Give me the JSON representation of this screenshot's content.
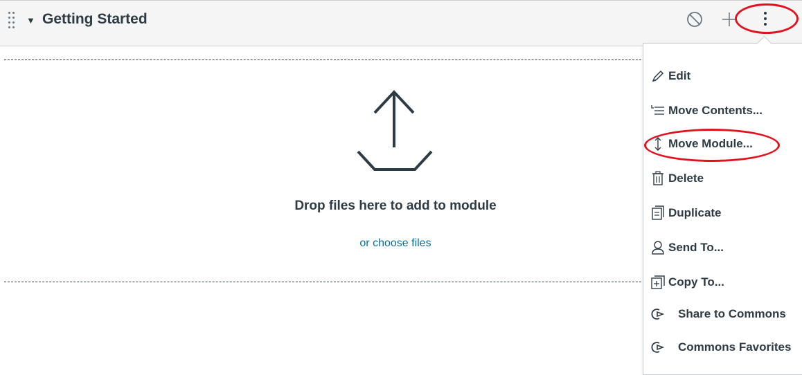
{
  "module": {
    "title": "Getting Started",
    "collapse_icon": "caret-down-icon",
    "drag_icon": "drag-handle-icon",
    "publish_icon": "unpublished-icon",
    "add_icon": "plus-icon",
    "settings_icon": "kebab-menu-icon"
  },
  "dropzone": {
    "icon": "upload-icon",
    "message": "Drop files here to add to module",
    "link_label": "or choose files"
  },
  "menu": {
    "items": [
      {
        "label": "Edit",
        "icon": "pencil-icon"
      },
      {
        "label": "Move Contents...",
        "icon": "move-contents-icon"
      },
      {
        "label": "Move Module...",
        "icon": "move-updown-icon"
      },
      {
        "label": "Delete",
        "icon": "trash-icon"
      },
      {
        "label": "Duplicate",
        "icon": "duplicate-icon"
      },
      {
        "label": "Send To...",
        "icon": "send-user-icon"
      },
      {
        "label": "Copy To...",
        "icon": "copy-to-icon"
      },
      {
        "label": "Share to Commons",
        "icon": "commons-icon"
      },
      {
        "label": "Commons Favorites",
        "icon": "commons-icon"
      }
    ]
  },
  "colors": {
    "text": "#2d3b45",
    "link": "#0770a3",
    "highlight": "#e3131d",
    "header_bg": "#f5f5f5"
  }
}
